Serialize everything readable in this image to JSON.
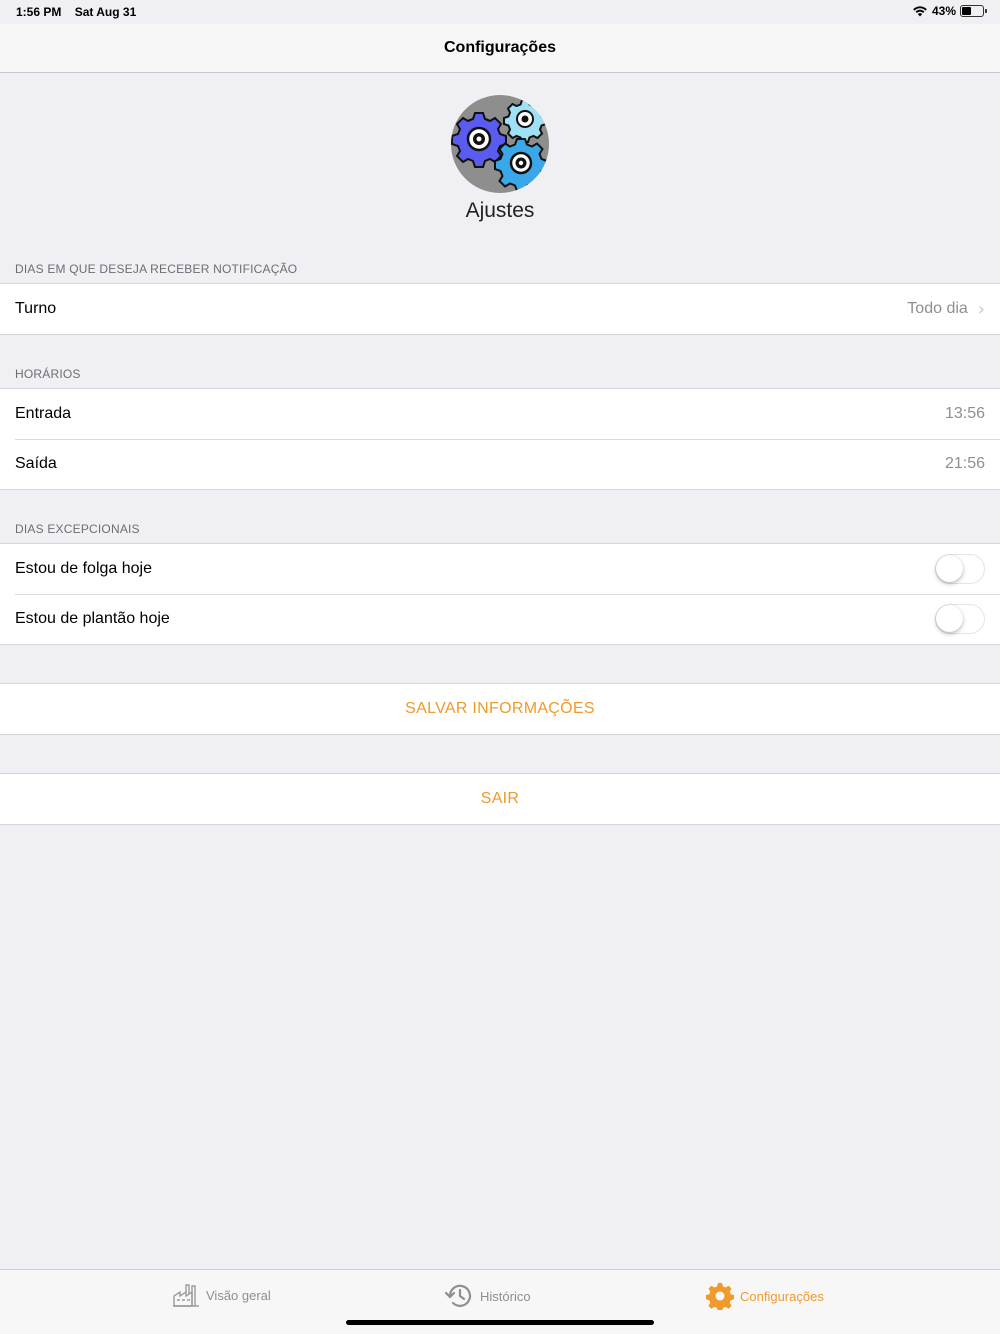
{
  "status_bar": {
    "time": "1:56 PM",
    "date": "Sat Aug 31",
    "battery": "43%",
    "battery_level": 0.43
  },
  "nav": {
    "title": "Configurações"
  },
  "profile": {
    "name": "Ajustes"
  },
  "sections": {
    "notificacao": {
      "header": "DIAS EM QUE DESEJA RECEBER NOTIFICAÇÃO",
      "turno_label": "Turno",
      "turno_value": "Todo dia"
    },
    "horarios": {
      "header": "HORÁRIOS",
      "entrada_label": "Entrada",
      "entrada_value": "13:56",
      "saida_label": "Saída",
      "saida_value": "21:56"
    },
    "excepcionais": {
      "header": "DIAS EXCEPCIONAIS",
      "folga_label": "Estou de folga hoje",
      "folga_on": false,
      "plantao_label": "Estou de plantão hoje",
      "plantao_on": false
    }
  },
  "buttons": {
    "save": "SALVAR INFORMAÇÕES",
    "logout": "SAIR"
  },
  "tabs": [
    {
      "label": "Visão geral",
      "icon": "factory-icon"
    },
    {
      "label": "Histórico",
      "icon": "history-icon"
    },
    {
      "label": "Configurações",
      "icon": "gear-icon",
      "active": true
    }
  ],
  "colors": {
    "accent": "#f09a2c",
    "background": "#efeff4"
  }
}
